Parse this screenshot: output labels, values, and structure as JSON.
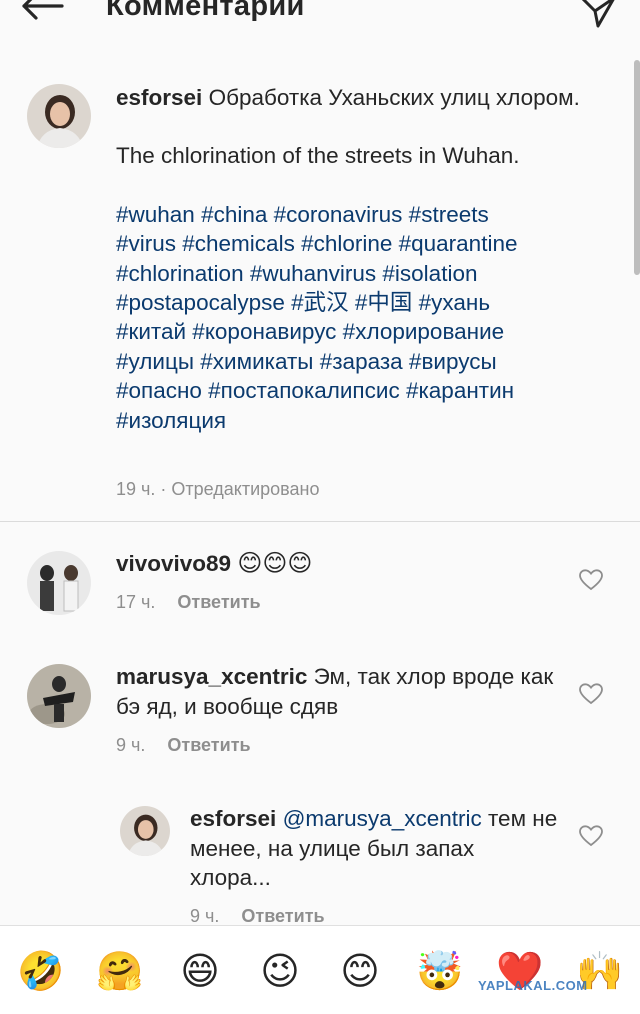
{
  "header": {
    "title": "Комментарии",
    "back_icon": "arrow-left-icon",
    "send_icon": "paper-plane-icon"
  },
  "post": {
    "username": "esforsei",
    "text_ru": "Обработка Уханьских улиц хлором.",
    "text_en": "The chlorination of the streets in Wuhan.",
    "hashtags": [
      "#wuhan #china #coronavirus #streets",
      "#virus #chemicals #chlorine #quarantine",
      "#chlorination #wuhanvirus #isolation",
      "#postapocalypse #武汉 #中国 #ухань",
      "#китай #коронавирус #хлорирование",
      "#улицы #химикаты #зараза #вирусы",
      "#опасно #постапокалипсис #карантин",
      "#изоляция"
    ],
    "meta": "19 ч. · Отредактировано"
  },
  "comments": [
    {
      "username": "vivovivo89",
      "text": "😊😊😊",
      "time": "17 ч.",
      "reply_label": "Ответить"
    },
    {
      "username": "marusya_xcentric",
      "text": "Эм, так хлор вроде как бэ яд, и вообще сдяв",
      "time": "9 ч.",
      "reply_label": "Ответить"
    },
    {
      "username": "esforsei",
      "mention": "@marusya_xcentric",
      "text": "тем не менее, на улице был запах хлора...",
      "time": "9 ч.",
      "reply_label": "Ответить"
    }
  ],
  "emoji_bar": [
    "🤣",
    "🤗",
    "😄",
    "😉",
    "😊",
    "🤯",
    "❤️",
    "🙌"
  ],
  "watermark": "YAPLAKAL.COM",
  "colors": {
    "hashtag": "#0b3a6e",
    "muted": "#8e8e8e",
    "text": "#262626",
    "background": "#fafafa"
  }
}
